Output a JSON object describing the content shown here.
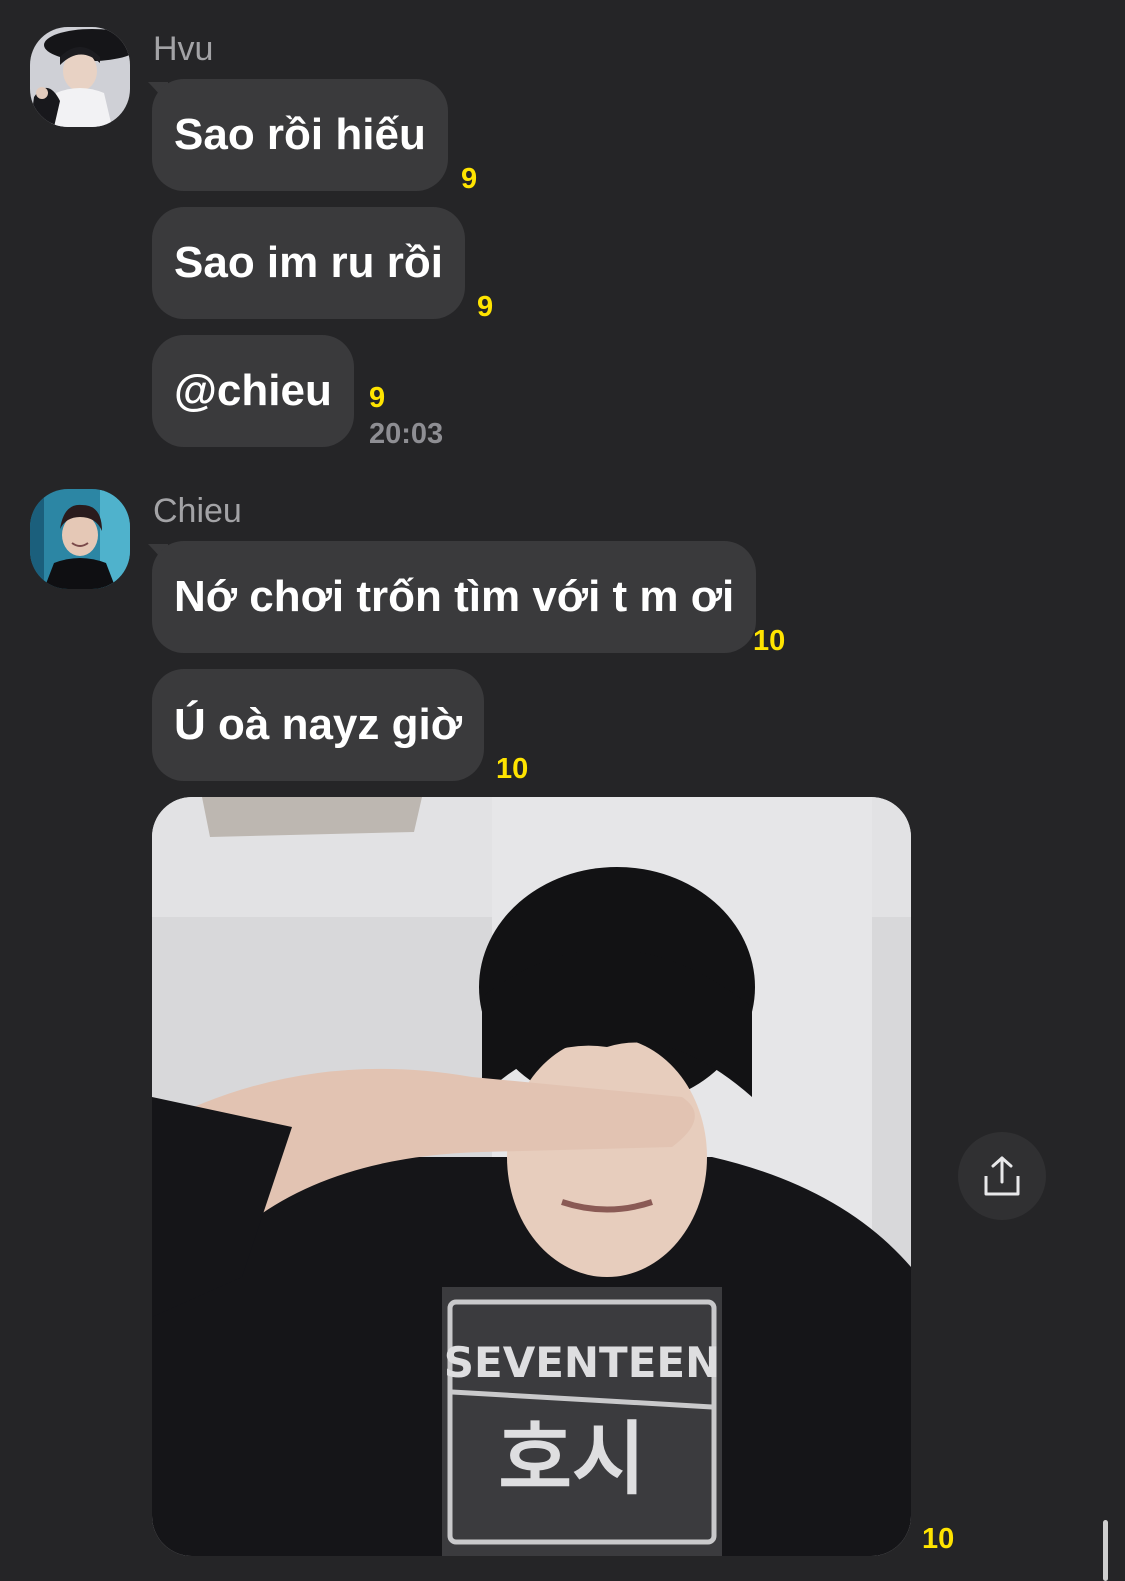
{
  "group1": {
    "sender": "Hvu",
    "messages": [
      {
        "text": "Sao rồi hiếu",
        "unread": "9"
      },
      {
        "text": "Sao im ru rồi",
        "unread": "9"
      },
      {
        "text": "@chieu",
        "unread": "9",
        "time": "20:03"
      }
    ]
  },
  "group2": {
    "sender": "Chieu",
    "messages": [
      {
        "text": "Nớ chơi trốn tìm với t m ơi",
        "unread": "10"
      },
      {
        "text": "Ú oà nayz giờ",
        "unread": "10"
      }
    ],
    "photo": {
      "unread": "10",
      "shirt_text_line1": "SEVENTEEN",
      "shirt_text_line2": "호시"
    }
  },
  "colors": {
    "background": "#252527",
    "bubble": "#3a3a3c",
    "unread": "#ffe400",
    "sender": "#a3a3a6"
  },
  "icons": {
    "share": "share-icon"
  }
}
